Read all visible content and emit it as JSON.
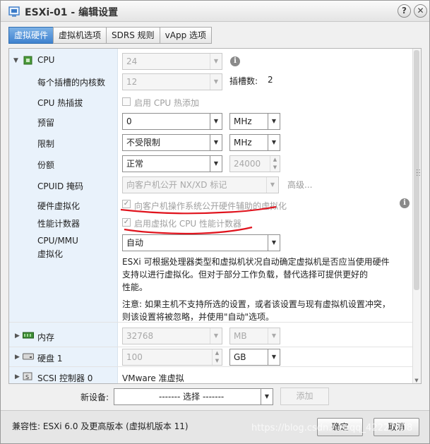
{
  "window": {
    "title": "ESXi-01 - 编辑设置",
    "help_label": "?",
    "close_label": "✕"
  },
  "tabs": [
    {
      "label": "虚拟硬件",
      "active": true
    },
    {
      "label": "虚拟机选项",
      "active": false
    },
    {
      "label": "SDRS 规则",
      "active": false
    },
    {
      "label": "vApp 选项",
      "active": false
    }
  ],
  "cpu": {
    "label": "CPU",
    "value": "24",
    "cores_label": "每个插槽的内核数",
    "cores_value": "12",
    "sockets_label": "插槽数:",
    "sockets_value": "2",
    "hotplug_label": "CPU 热插拔",
    "hotplug_checkbox": "启用 CPU 热添加",
    "reservation_label": "预留",
    "reservation_value": "0",
    "reservation_unit": "MHz",
    "limit_label": "限制",
    "limit_value": "不受限制",
    "limit_unit": "MHz",
    "shares_label": "份额",
    "shares_value": "正常",
    "shares_number": "24000",
    "cpuid_label": "CPUID 掩码",
    "cpuid_value": "向客户机公开 NX/XD 标记",
    "cpuid_advanced": "高级...",
    "hwvirt_label": "硬件虚拟化",
    "hwvirt_checkbox": "向客户机操作系统公开硬件辅助的虚拟化",
    "perfcounter_label": "性能计数器",
    "perfcounter_checkbox": "启用虚拟化 CPU 性能计数器",
    "mmu_label_line1": "CPU/MMU",
    "mmu_label_line2": "虚拟化",
    "mmu_value": "自动",
    "mmu_desc1_line1": "ESXi 可根据处理器类型和虚拟机状况自动确定虚拟机是否应当使用硬件",
    "mmu_desc1_line2": "支持以进行虚拟化。但对于部分工作负载，替代选择可提供更好的",
    "mmu_desc1_line3": "性能。",
    "mmu_desc2_line1": "注意: 如果主机不支持所选的设置，或者该设置与现有虚拟机设置冲突，",
    "mmu_desc2_line2": "则该设置将被忽略，并使用\"自动\"选项。"
  },
  "memory": {
    "label": "内存",
    "value": "32768",
    "unit": "MB"
  },
  "disk": {
    "label": "硬盘 1",
    "value": "100",
    "unit": "GB"
  },
  "scsi": {
    "label": "SCSI 控制器 0",
    "value": "VMware 准虚拟"
  },
  "new_device": {
    "label": "新设备:",
    "select_value": "------- 选择 -------",
    "add_label": "添加"
  },
  "footer": {
    "compat": "兼容性: ESXi 6.0 及更高版本 (虚拟机版本 11)",
    "ok_label": "确定",
    "cancel_label": "取消",
    "watermark": "https://blog.csdn.net/qq_42227008"
  },
  "colors": {
    "accent_tab": "#3f82cf",
    "annotation_red": "#e0141e"
  }
}
